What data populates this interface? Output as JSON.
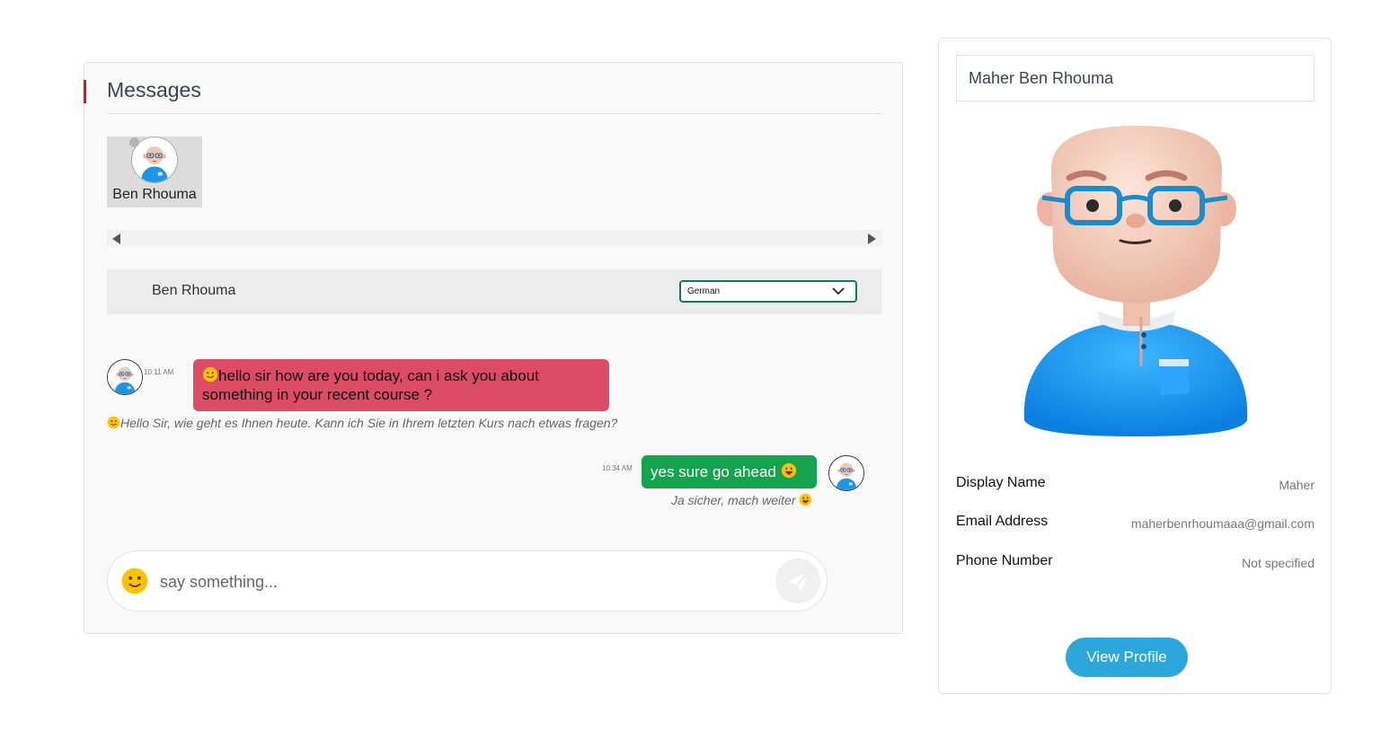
{
  "messages_panel": {
    "title": "Messages",
    "contacts": [
      {
        "name": "Ben Rhouma"
      }
    ],
    "chat_header": {
      "name": "Ben Rhouma",
      "language_selected": "German"
    },
    "conversation": [
      {
        "direction": "incoming",
        "time": "10:11 AM",
        "text": "hello sir how are you today, can i ask you about something in your recent course ?",
        "translation": "Hello Sir, wie geht es Ihnen heute. Kann ich Sie in Ihrem letzten Kurs nach etwas fragen?",
        "emoji": "smiling-face-icon"
      },
      {
        "direction": "outgoing",
        "time": "10:34 AM",
        "text": "yes sure go ahead",
        "translation": "Ja sicher, mach weiter",
        "emoji": "grinning-face-icon"
      }
    ],
    "composer": {
      "placeholder": "say something..."
    }
  },
  "profile_card": {
    "full_name": "Maher Ben Rhouma",
    "fields": [
      {
        "label": "Display Name",
        "value": "Maher"
      },
      {
        "label": "Email Address",
        "value": "maherbenrhoumaaa@gmail.com"
      },
      {
        "label": "Phone Number",
        "value": "Not specified"
      }
    ],
    "button_label": "View Profile"
  },
  "colors": {
    "accent_red": "#d9161c",
    "incoming_bubble": "#dc4c64",
    "outgoing_bubble": "#14a44d",
    "language_border": "#18794e",
    "view_profile_button": "#2ba7dc"
  }
}
